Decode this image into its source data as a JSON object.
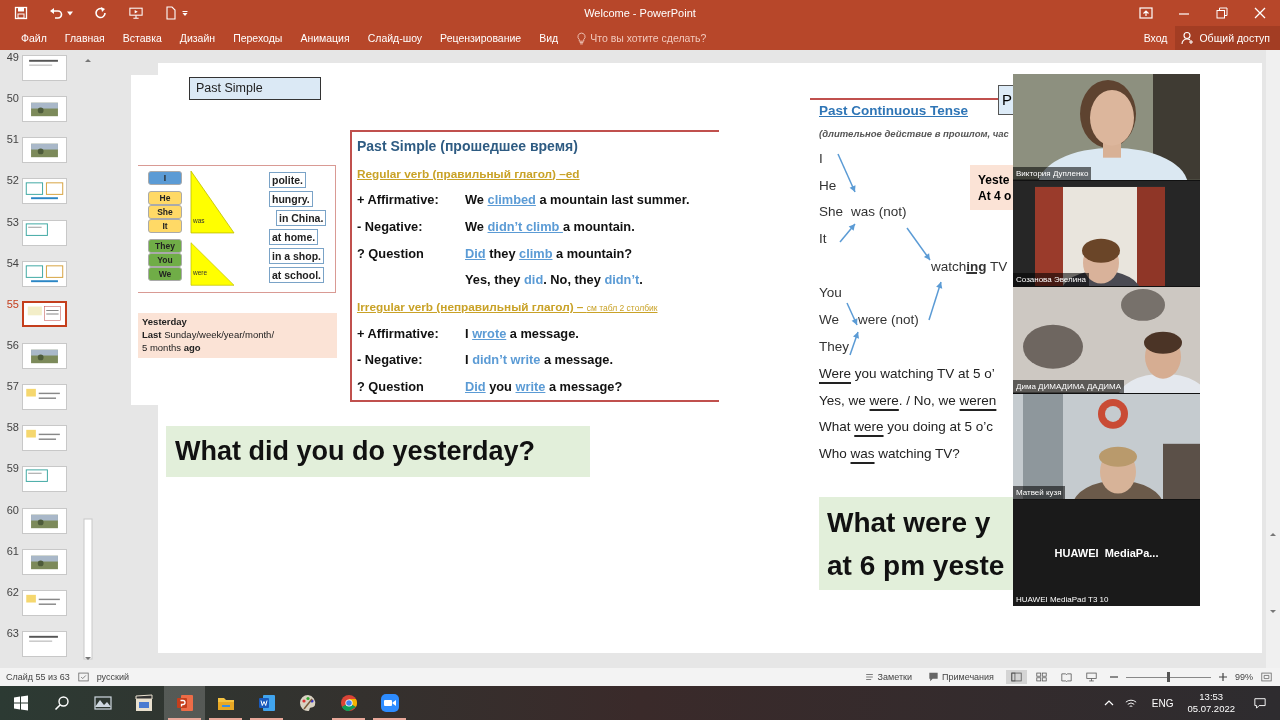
{
  "window": {
    "title": "Welcome - PowerPoint"
  },
  "ribbon": {
    "tabs": [
      {
        "label": "Файл",
        "selected": false
      },
      {
        "label": "Главная",
        "selected": false
      },
      {
        "label": "Вставка",
        "selected": false
      },
      {
        "label": "Дизайн",
        "selected": false
      },
      {
        "label": "Переходы",
        "selected": false
      },
      {
        "label": "Анимация",
        "selected": false
      },
      {
        "label": "Слайд-шоу",
        "selected": false
      },
      {
        "label": "Рецензирование",
        "selected": false
      },
      {
        "label": "Вид",
        "selected": false
      }
    ],
    "tell_me": {
      "placeholder": "Что вы хотите сделать?"
    },
    "sign_in": "Вход",
    "share": "Общий доступ"
  },
  "thumbnails": [
    {
      "number": "49",
      "selected": false
    },
    {
      "number": "50",
      "selected": false
    },
    {
      "number": "51",
      "selected": false
    },
    {
      "number": "52",
      "selected": false
    },
    {
      "number": "53",
      "selected": false
    },
    {
      "number": "54",
      "selected": false
    },
    {
      "number": "55",
      "selected": true
    },
    {
      "number": "56",
      "selected": false
    },
    {
      "number": "57",
      "selected": false
    },
    {
      "number": "58",
      "selected": false
    },
    {
      "number": "59",
      "selected": false
    },
    {
      "number": "60",
      "selected": false
    },
    {
      "number": "61",
      "selected": false
    },
    {
      "number": "62",
      "selected": false
    },
    {
      "number": "63",
      "selected": false
    }
  ],
  "slide": {
    "past_simple": {
      "label": "Past Simple",
      "groups": [
        {
          "verb": "was",
          "pronouns": [
            {
              "text": "I",
              "color": "#5b9bd5"
            },
            {
              "text": "He",
              "color": "#ffd966"
            },
            {
              "text": "She",
              "color": "#ffd966"
            },
            {
              "text": "It",
              "color": "#ffd966"
            }
          ]
        },
        {
          "verb": "were",
          "pronouns": [
            {
              "text": "They",
              "color": "#70ad47"
            },
            {
              "text": "You",
              "color": "#70ad47"
            },
            {
              "text": "We",
              "color": "#70ad47"
            }
          ]
        }
      ],
      "complements": [
        "polite.",
        "hungry.",
        "in China.",
        "at home.",
        "in a shop.",
        "at school."
      ],
      "time_note": [
        "**Yesterday**",
        "**Last** Sunday/week/year/month/",
        "5 months **ago**"
      ],
      "rules": [
        {
          "kind": "title",
          "parts": [
            {
              "text": "Past Simple (прошедшее время)",
              "kind": "title"
            }
          ]
        },
        {
          "kind": "heading",
          "parts": [
            {
              "text": "Regular verb (правильный глагол) –ed",
              "kind": "heading"
            }
          ]
        },
        {
          "kind": "row",
          "label": "+ Affirmative:",
          "parts": [
            {
              "text": "We ",
              "kind": "plain"
            },
            {
              "text": "climbed",
              "kind": "underlined_blue"
            },
            {
              "text": " a mountain last summer.",
              "kind": "plain"
            }
          ]
        },
        {
          "kind": "row",
          "label": "-  Negative:",
          "parts": [
            {
              "text": "We ",
              "kind": "plain"
            },
            {
              "text": "didn’t climb ",
              "kind": "underlined_blue"
            },
            {
              "text": "a mountain.",
              "kind": "plain"
            }
          ]
        },
        {
          "kind": "row",
          "label": "? Question",
          "parts": [
            {
              "text": "Did",
              "kind": "underlined_blue"
            },
            {
              "text": " they ",
              "kind": "plain"
            },
            {
              "text": "climb",
              "kind": "underlined_blue"
            },
            {
              "text": " a mountain?",
              "kind": "plain"
            }
          ]
        },
        {
          "kind": "row",
          "parts": [
            {
              "text": "Yes, they ",
              "kind": "plain"
            },
            {
              "text": "did",
              "kind": "blue"
            },
            {
              "text": ". No, they ",
              "kind": "plain"
            },
            {
              "text": "didn’t",
              "kind": "blue"
            },
            {
              "text": ".",
              "kind": "plain"
            }
          ]
        },
        {
          "kind": "heading",
          "parts": [
            {
              "text": "Irregular verb (неправильный глагол) – ",
              "kind": "heading"
            },
            {
              "text": "см табл 2 столбик",
              "kind": "small"
            }
          ]
        },
        {
          "kind": "row",
          "label": "+ Affirmative:",
          "parts": [
            {
              "text": "I ",
              "kind": "plain"
            },
            {
              "text": "wrote",
              "kind": "underlined_blue"
            },
            {
              "text": " a message.",
              "kind": "plain"
            }
          ]
        },
        {
          "kind": "row",
          "label": "-  Negative:",
          "parts": [
            {
              "text": "I ",
              "kind": "plain"
            },
            {
              "text": "didn’t write",
              "kind": "blue"
            },
            {
              "text": " a message.",
              "kind": "plain"
            }
          ]
        },
        {
          "kind": "row",
          "label": "? Question",
          "parts": [
            {
              "text": "Did",
              "kind": "underlined_blue"
            },
            {
              "text": " you ",
              "kind": "plain"
            },
            {
              "text": "write",
              "kind": "underlined_blue"
            },
            {
              "text": " a message?",
              "kind": "plain"
            }
          ]
        }
      ]
    },
    "question_left": "What did you do yesterday?",
    "past_continuous": {
      "tab_letter": "P",
      "title": "Past Continuous Tense",
      "subtitle": "(длительное действие в прошлом, час",
      "singular": [
        "I",
        "He",
        "She",
        "It"
      ],
      "singular_verb": "was (not)",
      "participle": "watch**ing** TV",
      "plural": [
        "You",
        "We",
        "They"
      ],
      "plural_verb": "were (not)",
      "callout": [
        "Yeste",
        "At 4 o"
      ],
      "questions": [
        [
          {
            "text": "Were",
            "kind": "underlined"
          },
          {
            "text": " you watching TV at 5 o’",
            "kind": "plain"
          }
        ],
        [
          {
            "text": "Yes, we ",
            "kind": "plain"
          },
          {
            "text": "were",
            "kind": "underlined"
          },
          {
            "text": ". / No, we ",
            "kind": "plain"
          },
          {
            "text": "weren",
            "kind": "underlined"
          }
        ],
        [
          {
            "text": "What ",
            "kind": "plain"
          },
          {
            "text": "were",
            "kind": "underlined"
          },
          {
            "text": " you doing at 5 o’c",
            "kind": "plain"
          }
        ],
        [
          {
            "text": "Who ",
            "kind": "plain"
          },
          {
            "text": "was",
            "kind": "underlined"
          },
          {
            "text": " watching TV?",
            "kind": "plain"
          }
        ]
      ],
      "question_right": [
        "What were y",
        "at 6 pm yeste"
      ]
    }
  },
  "video_call": {
    "participants": [
      {
        "name": "Виктория Дупленко",
        "kind": "camera"
      },
      {
        "name": "Созанова Эвелина",
        "kind": "camera"
      },
      {
        "name": "Дима ДИМАДИМА ДАДИМА",
        "kind": "camera"
      },
      {
        "name": "Матвей кузя",
        "kind": "camera"
      },
      {
        "name": "HUAWEI MediaPad T3 10",
        "kind": "no_video",
        "display": "HUAWEI  MediaPa..."
      }
    ]
  },
  "status_bar": {
    "slide_info": "Слайд 55 из 63",
    "language": "русский",
    "notes": "Заметки",
    "comments": "Примечания",
    "views": [
      {
        "kind": "normal",
        "selected": true
      },
      {
        "kind": "sorter",
        "selected": false
      },
      {
        "kind": "reading",
        "selected": false
      },
      {
        "kind": "slideshow",
        "selected": false
      }
    ],
    "zoom": {
      "level": 0.5,
      "value": "99%"
    }
  },
  "taskbar": {
    "apps": [
      {
        "kind": "gallery",
        "selected": false,
        "running": false
      },
      {
        "kind": "media",
        "selected": false,
        "running": false
      },
      {
        "kind": "powerpoint",
        "selected": true,
        "running": true
      },
      {
        "kind": "explorer",
        "selected": false,
        "running": true
      },
      {
        "kind": "word",
        "selected": false,
        "running": true
      },
      {
        "kind": "paint",
        "selected": false,
        "running": false
      },
      {
        "kind": "chrome",
        "selected": false,
        "running": true
      },
      {
        "kind": "zoom",
        "selected": false,
        "running": true
      }
    ],
    "language": "ENG",
    "time": "13:53",
    "date": "05.07.2022"
  }
}
